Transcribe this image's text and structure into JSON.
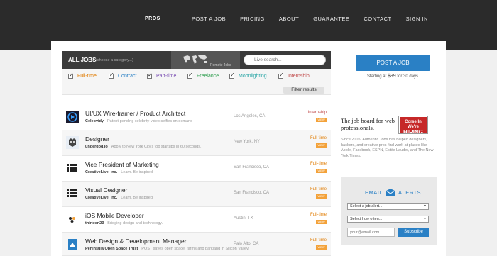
{
  "header": {
    "logo": "PROS",
    "nav": [
      "POST A JOB",
      "PRICING",
      "ABOUT",
      "GUARANTEE",
      "CONTACT",
      "SIGN IN"
    ]
  },
  "filters": {
    "all_jobs": "ALL JOBS",
    "choose": "(choose a category...)",
    "remote": "Remote Jobs",
    "search_placeholder": "Live search...",
    "types": [
      {
        "label": "Full-time",
        "color": "#e07b00"
      },
      {
        "label": "Contract",
        "color": "#2a80c5"
      },
      {
        "label": "Part-time",
        "color": "#7a4fb3"
      },
      {
        "label": "Freelance",
        "color": "#2e9e4f"
      },
      {
        "label": "Moonlighting",
        "color": "#2aa6a6"
      },
      {
        "label": "Internship",
        "color": "#c14d4d"
      }
    ],
    "filter_button": "Filter results"
  },
  "jobs": [
    {
      "title": "UI/UX Wire-framer / Product Architect",
      "company": "Celebvidy",
      "desc": "Patent-pending celebrity video selfies on demand",
      "location": "Los Angeles, CA",
      "type": "Internship",
      "badge": "VIEW"
    },
    {
      "title": "Designer",
      "company": "underdog.io",
      "desc": "Apply to New York City's top startups in 60 seconds.",
      "location": "New York, NY",
      "type": "Full-time",
      "badge": "VIEW"
    },
    {
      "title": "Vice President of Marketing",
      "company": "CreativeLive, Inc.",
      "desc": "Learn. Be inspired.",
      "location": "San Francisco, CA",
      "type": "Full-time",
      "badge": "VIEW"
    },
    {
      "title": "Visual Designer",
      "company": "CreativeLive, Inc.",
      "desc": "Learn. Be inspired.",
      "location": "San Francisco, CA",
      "type": "Full-time",
      "badge": "VIEW"
    },
    {
      "title": "iOS Mobile Developer",
      "company": "thirteen23",
      "desc": "Bridging design and technology.",
      "location": "Austin, TX",
      "type": "Full-time",
      "badge": "VIEW"
    },
    {
      "title": "Web Design & Development Manager",
      "company": "Peninsula Open Space Trust",
      "desc": "POST saves open space, farms and parkland in Silicon Valley!",
      "location": "Palo Alto, CA",
      "type": "Full-time",
      "badge": "VIEW"
    }
  ],
  "sidebar": {
    "post_button": "POST A JOB",
    "starting_prefix": "Starting at",
    "price": "$99",
    "starting_suffix": "for 30 days",
    "title": "The job board for web professionals.",
    "hiring_line1": "Come In We're",
    "hiring_line2": "HIRING",
    "desc": "Since 2005, Authentic Jobs has helped designers, hackers, and creative pros find work at places like Apple, Facebook, ESPN, Estée Lauder, and The New York Times.",
    "alerts_email": "EMAIL",
    "alerts_label": "ALERTS",
    "select_alert": "Select a job alert...",
    "select_often": "Select how often...",
    "email_placeholder": "your@email.com",
    "subscribe": "Subscribe"
  }
}
